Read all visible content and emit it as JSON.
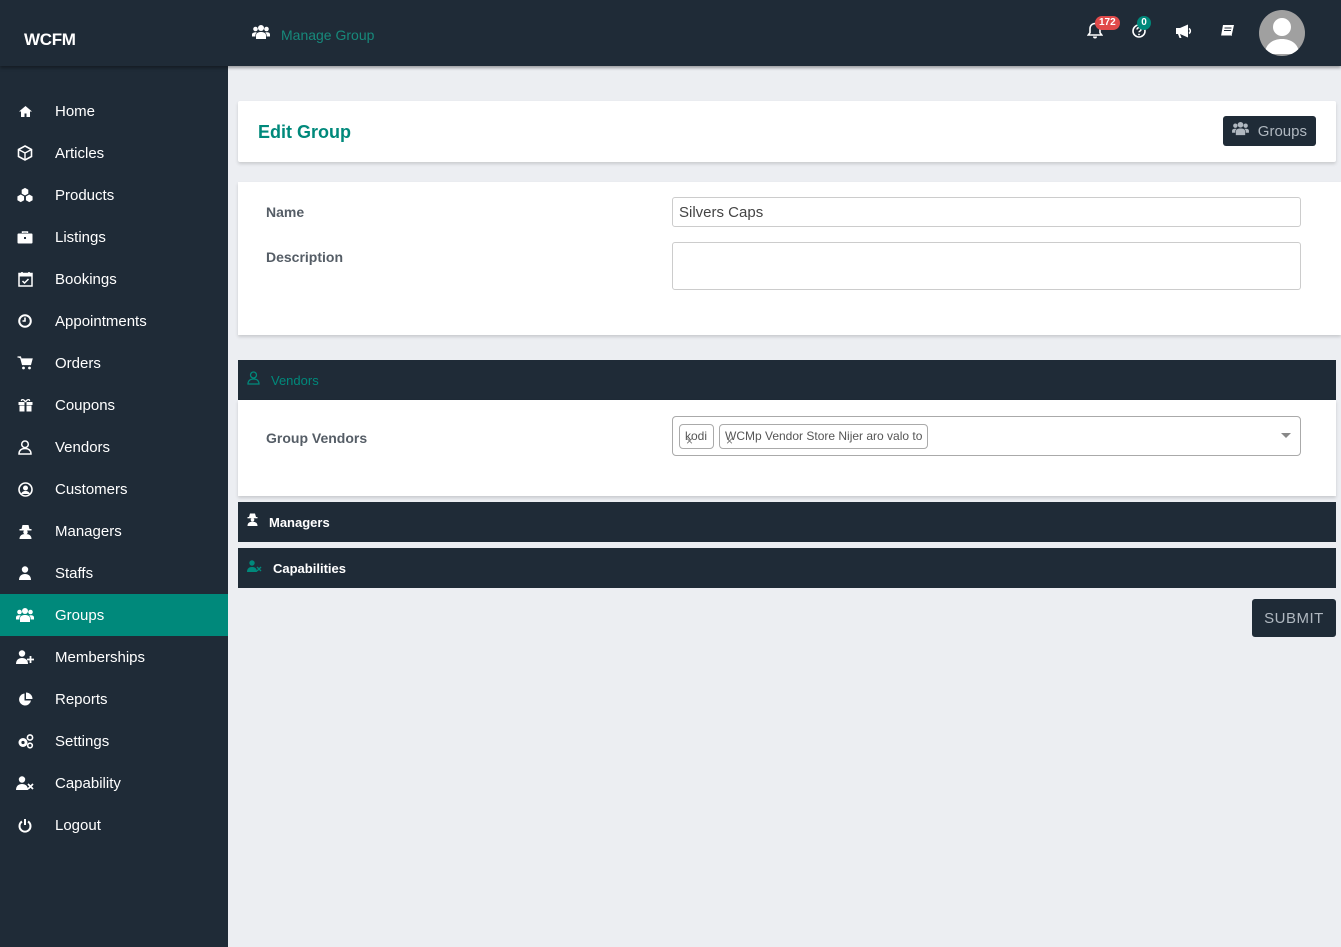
{
  "app": {
    "brand": "WCFM"
  },
  "header": {
    "breadcrumb": "Manage Group",
    "icons": [
      {
        "name": "bell-icon",
        "badge": "172"
      },
      {
        "name": "help-icon",
        "badge": "0"
      },
      {
        "name": "megaphone-icon",
        "badge": null
      },
      {
        "name": "book-icon",
        "badge": null
      }
    ]
  },
  "sidebar": {
    "items": [
      {
        "label": "Home",
        "icon": "home-icon"
      },
      {
        "label": "Articles",
        "icon": "cube-icon"
      },
      {
        "label": "Products",
        "icon": "cubes-icon"
      },
      {
        "label": "Listings",
        "icon": "briefcase-icon"
      },
      {
        "label": "Bookings",
        "icon": "calendar-check-icon"
      },
      {
        "label": "Appointments",
        "icon": "clock-icon"
      },
      {
        "label": "Orders",
        "icon": "cart-icon"
      },
      {
        "label": "Coupons",
        "icon": "gift-icon"
      },
      {
        "label": "Vendors",
        "icon": "user-outline-icon"
      },
      {
        "label": "Customers",
        "icon": "user-circle-icon"
      },
      {
        "label": "Managers",
        "icon": "user-secret-icon"
      },
      {
        "label": "Staffs",
        "icon": "user-icon"
      },
      {
        "label": "Groups",
        "icon": "users-icon",
        "active": true
      },
      {
        "label": "Memberships",
        "icon": "user-plus-icon"
      },
      {
        "label": "Reports",
        "icon": "pie-chart-icon"
      },
      {
        "label": "Settings",
        "icon": "cogs-icon"
      },
      {
        "label": "Capability",
        "icon": "user-times-icon"
      },
      {
        "label": "Logout",
        "icon": "power-icon"
      }
    ]
  },
  "page": {
    "title": "Edit Group",
    "groups_button": "Groups",
    "form": {
      "name_label": "Name",
      "name_value": "Silvers Caps",
      "description_label": "Description",
      "description_value": ""
    },
    "vendors_section": {
      "title": "Vendors",
      "field_label": "Group Vendors",
      "selected": [
        "kodi",
        "WCMp Vendor Store Nijer aro valo to"
      ],
      "remove_glyph": "×"
    },
    "managers_section": {
      "title": "Managers"
    },
    "capabilities_section": {
      "title": "Capabilities"
    },
    "submit_label": "SUBMIT"
  },
  "colors": {
    "accent": "#00897b",
    "dark": "#1f2b37",
    "badge_red": "#e04a4a"
  }
}
